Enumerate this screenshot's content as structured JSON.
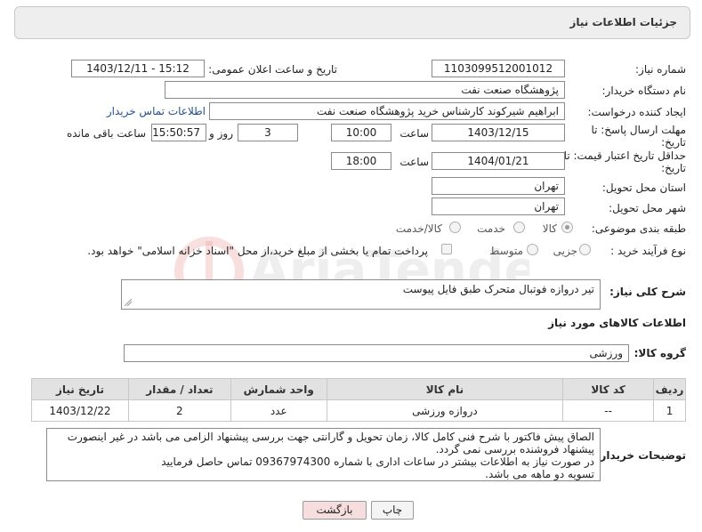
{
  "panel": {
    "title": "جزئیات اطلاعات نیاز"
  },
  "fields": {
    "need_number_label": "شماره نیاز:",
    "need_number": "1103099512001012",
    "announce_label": "تاریخ و ساعت اعلان عمومی:",
    "announce_value": "1403/12/11 - 15:12",
    "buyer_label": "نام دستگاه خریدار:",
    "buyer_value": "پژوهشگاه صنعت نفت",
    "creator_label": "ایجاد کننده درخواست:",
    "creator_value": "ابراهیم شیرکوند کارشناس خرید پژوهشگاه صنعت نفت",
    "contact_link": "اطلاعات تماس خریدار",
    "deadline_label_1": "مهلت ارسال پاسخ: تا",
    "deadline_label_2": "تاریخ:",
    "deadline_date": "1403/12/15",
    "time_label": "ساعت",
    "deadline_time": "10:00",
    "days_value": "3",
    "days_label": "روز و",
    "remaining_time": "15:50:57",
    "remaining_label": "ساعت باقی مانده",
    "validity_label_1": "حداقل تاریخ اعتبار قیمت: تا",
    "validity_label_2": "تاریخ:",
    "validity_date": "1404/01/21",
    "validity_time_label": "ساعت",
    "validity_time": "18:00",
    "province_label": "استان محل تحویل:",
    "province_value": "تهران",
    "city_label": "شهر محل تحویل:",
    "city_value": "تهران",
    "category_label": "طبقه بندی موضوعی:",
    "category_options": [
      "کالا",
      "خدمت",
      "کالا/خدمت"
    ],
    "purchase_label": "نوع فرآیند خرید :",
    "purchase_options": [
      "جزیی",
      "متوسط"
    ],
    "payment_note": "پرداخت تمام یا بخشی از مبلغ خرید،از محل \"اسناد خزانه اسلامی\" خواهد بود.",
    "summary_label": "شرح کلی نیاز:",
    "summary_value": "تیر دروازه فوتبال متحرک طبق فایل پیوست",
    "goods_info_title": "اطلاعات کالاهای مورد نیاز",
    "group_label": "گروه کالا:",
    "group_value": "ورزشی",
    "buyer_notes_label": "توضیحات خریدار:",
    "buyer_notes": [
      "الصاق پیش فاکتور با شرح فنی کامل کالا، زمان تحویل و گارانتی جهت بررسی پیشنهاد الزامی می باشد در غیر اینصورت",
      "پیشنهاد فروشنده بررسی نمی گردد.",
      "در صورت نیاز به اطلاعات بیشتر در ساعات اداری با شماره 09367974300 تماس حاصل فرمایید",
      "تسویه دو ماهه می باشد."
    ]
  },
  "table": {
    "headers": [
      "ردیف",
      "کد کالا",
      "نام کالا",
      "واحد شمارش",
      "تعداد / مقدار",
      "تاریخ نیاز"
    ],
    "rows": [
      [
        "1",
        "--",
        "دروازه ورزشی",
        "عدد",
        "2",
        "1403/12/22"
      ]
    ]
  },
  "buttons": {
    "print": "چاپ",
    "back": "بازگشت"
  },
  "watermark": {
    "text": "AriaTender.net"
  },
  "colors": {
    "link": "#1e4fa8",
    "back_button_bg": "#f7dede",
    "header_bg": "#e2e2e2",
    "watermark": "#d9534f"
  }
}
